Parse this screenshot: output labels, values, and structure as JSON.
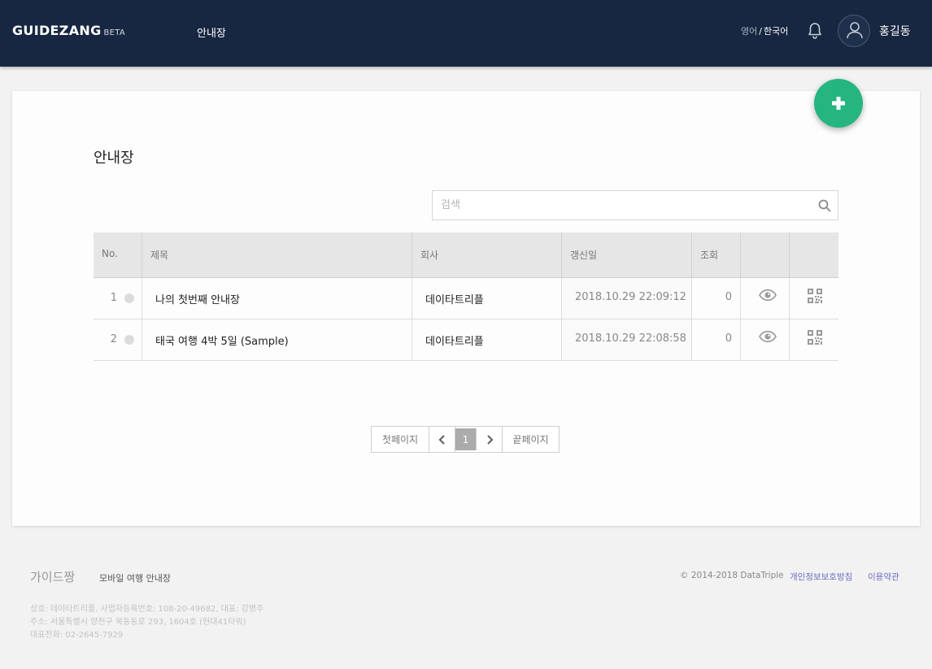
{
  "header": {
    "logo": "GUIDEZANG",
    "logo_badge": "BETA",
    "nav_link": "안내장",
    "lang_inactive": "영어",
    "lang_separator": "/",
    "lang_active": "한국어",
    "username": "홍길동"
  },
  "main": {
    "title": "안내장",
    "search_placeholder": "검색",
    "table": {
      "headers": [
        "No.",
        "제목",
        "회사",
        "갱신일",
        "조회",
        "",
        ""
      ],
      "rows": [
        {
          "no": "1",
          "title": "나의 첫번째 안내장",
          "company": "데이타트리플",
          "updated": "2018.10.29 22:09:12",
          "views": "0"
        },
        {
          "no": "2",
          "title": "태국 여행 4박 5일 (Sample)",
          "company": "데이타트리플",
          "updated": "2018.10.29 22:08:58",
          "views": "0"
        }
      ]
    },
    "pagination": {
      "first": "첫페이지",
      "current": "1",
      "last": "끝페이지"
    }
  },
  "footer": {
    "brand": "가이드짱",
    "tagline": "모바일 여행 안내장",
    "copyright": "© 2014-2018 DataTriple",
    "privacy_link": "개인정보보호방침",
    "terms_link": "이용약관",
    "info_lines": [
      "상호: 데이타트리플, 사업자등록번호: 108-20-49682, 대표: 강병주",
      "주소: 서울특별시 양천구 목동동로 293, 1604호 (현대41타워)",
      "대표전화: 02-2645-7929"
    ]
  },
  "colors": {
    "header_bg": "#172742",
    "accent_green": "#25b57f",
    "link_purple": "#6c6cc4"
  },
  "icons": {
    "bell": "bell-icon",
    "avatar": "user-icon",
    "fab": "plus-icon",
    "search": "search-icon",
    "view": "eye-icon",
    "qr": "qr-code-icon",
    "prev": "chevron-left-icon",
    "next": "chevron-right-icon"
  }
}
